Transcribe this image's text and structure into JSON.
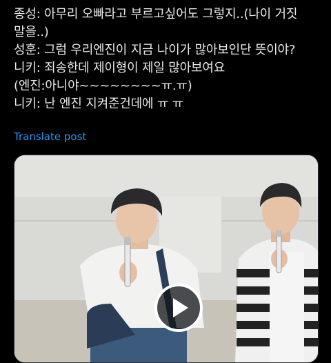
{
  "post": {
    "lines": [
      "종성: 아무리 오빠라고 부르고싶어도 그렇지..(나이 거짓",
      "말을..)",
      "성훈: 그럼 우리엔진이 지금 나이가 많아보인단 뜻이야?",
      "니키: 죄송한데 제이형이 제일 많아보여요",
      "(엔진:아니야~~~~~~~~ㅠ.ㅠ)",
      "니키: 난 엔진 지켜준건데에 ㅠ ㅠ"
    ],
    "translate_label": "Translate post"
  },
  "media": {
    "type": "video",
    "play_icon": "play-icon"
  },
  "colors": {
    "background": "#000000",
    "text": "#e7e9ea",
    "link": "#1d9bf0"
  }
}
